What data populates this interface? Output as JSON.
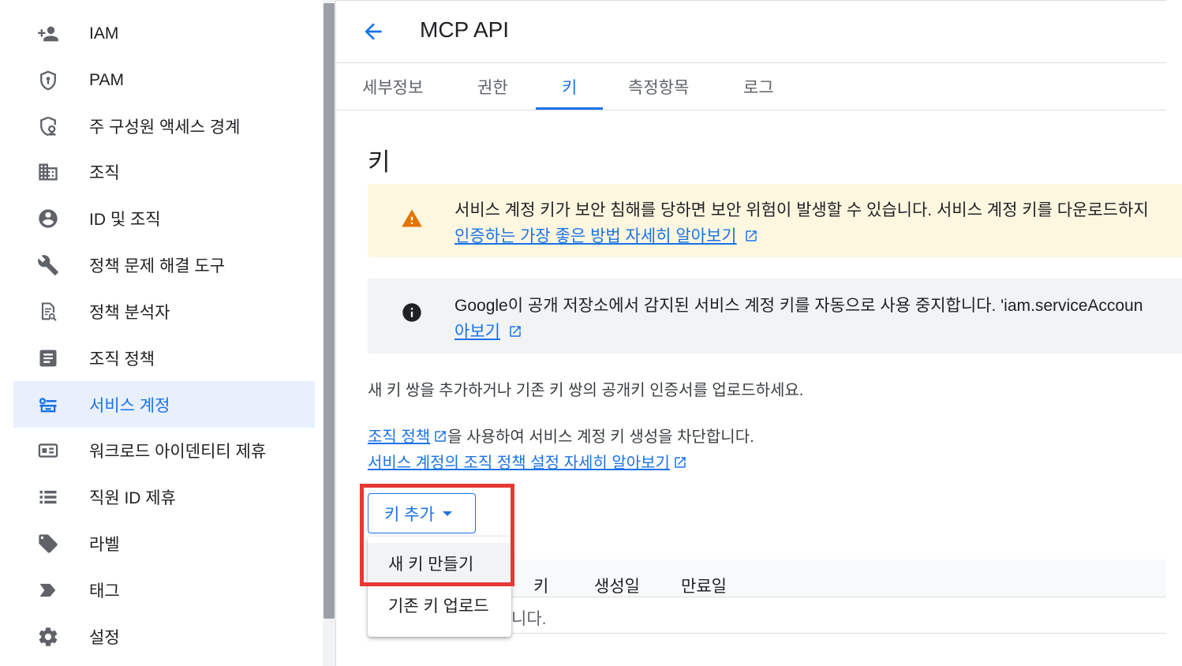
{
  "sidebar": {
    "items": [
      {
        "label": "IAM",
        "icon": "person-add-icon"
      },
      {
        "label": "PAM",
        "icon": "shield-icon"
      },
      {
        "label": "주 구성원 액세스 경계",
        "icon": "shield-person-icon"
      },
      {
        "label": "조직",
        "icon": "building-icon"
      },
      {
        "label": "ID 및 조직",
        "icon": "account-circle-icon"
      },
      {
        "label": "정책 문제 해결 도구",
        "icon": "wrench-icon"
      },
      {
        "label": "정책 분석자",
        "icon": "document-search-icon"
      },
      {
        "label": "조직 정책",
        "icon": "document-icon"
      },
      {
        "label": "서비스 계정",
        "icon": "service-account-icon",
        "active": true
      },
      {
        "label": "워크로드 아이덴티티 제휴",
        "icon": "id-card-icon"
      },
      {
        "label": "직원 ID 제휴",
        "icon": "list-icon"
      },
      {
        "label": "라벨",
        "icon": "label-tag-icon"
      },
      {
        "label": "태그",
        "icon": "tag-arrow-icon"
      },
      {
        "label": "설정",
        "icon": "gear-icon"
      }
    ]
  },
  "header": {
    "title": "MCP API"
  },
  "tabs": [
    {
      "label": "세부정보"
    },
    {
      "label": "권한"
    },
    {
      "label": "키",
      "active": true
    },
    {
      "label": "측정항목"
    },
    {
      "label": "로그"
    }
  ],
  "section_title": "키",
  "warning": {
    "text": "서비스 계정 키가 보안 침해를 당하면 보안 위험이 발생할 수 있습니다. 서비스 계정 키를 다운로드하지",
    "link": "인증하는 가장 좋은 방법 자세히 알아보기"
  },
  "info": {
    "text": "Google이 공개 저장소에서 감지된 서비스 계정 키를 자동으로 사용 중지합니다. 'iam.serviceAccoun",
    "link": "아보기"
  },
  "description": "새 키 쌍을 추가하거나 기존 키 쌍의 공개키 인증서를 업로드하세요.",
  "policy": {
    "link": "조직 정책",
    "text": "을 사용하여 서비스 계정 키 생성을 차단합니다.",
    "learn_more": "서비스 계정의 조직 정책 설정 자세히 알아보기"
  },
  "add_key_button": "키 추가",
  "menu": {
    "items": [
      "새 키 만들기",
      "기존 키 업로드"
    ]
  },
  "table": {
    "headers": [
      "키",
      "생성일",
      "만료일"
    ],
    "empty_text": "니다."
  },
  "colors": {
    "accent": "#1a73e8",
    "warning_bg": "#fef7e0",
    "warning_icon": "#e37400",
    "highlight": "#e53935"
  }
}
